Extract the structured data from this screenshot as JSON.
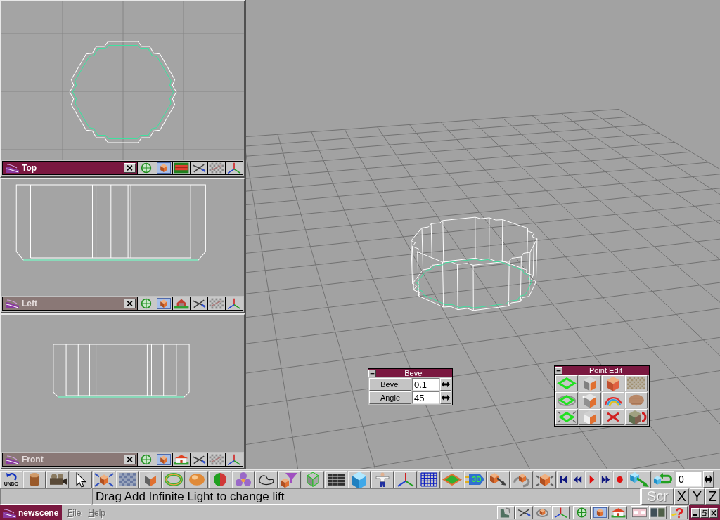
{
  "viewports": [
    {
      "title": "Top",
      "selected": true
    },
    {
      "title": "Left",
      "selected": false
    },
    {
      "title": "Front",
      "selected": false
    }
  ],
  "bevel_panel": {
    "title": "Bevel",
    "rows": [
      {
        "label": "Bevel",
        "value": "0.1"
      },
      {
        "label": "Angle",
        "value": "45"
      }
    ]
  },
  "point_edit_panel": {
    "title": "Point Edit"
  },
  "toolbar": {
    "undo_label": "UNDO",
    "render_label": "3D",
    "frame_field": {
      "value": "0"
    }
  },
  "status_bar": {
    "message": "Drag Add Infinite Light to change lift",
    "buttons": [
      {
        "label": "Scr",
        "disabled": true
      },
      {
        "label": "X",
        "disabled": false
      },
      {
        "label": "Y",
        "disabled": false
      },
      {
        "label": "Z",
        "disabled": false
      }
    ]
  },
  "taskbar": {
    "title": "newscene",
    "menu": [
      {
        "label": "File",
        "disabled": true
      },
      {
        "label": "Help",
        "disabled": true
      }
    ]
  }
}
